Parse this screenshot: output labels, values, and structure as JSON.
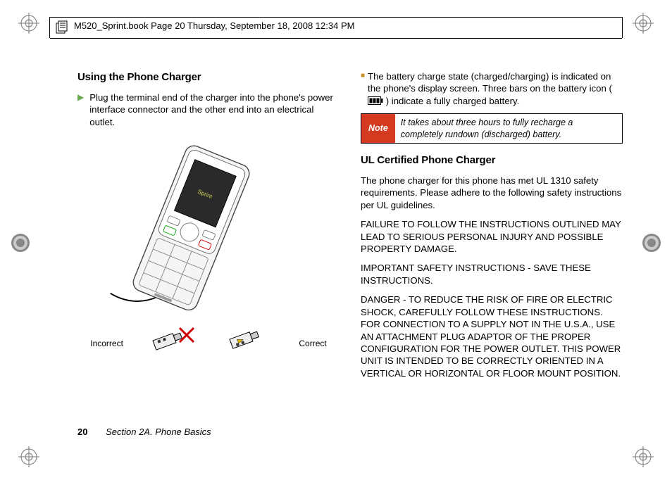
{
  "crop_header": "M520_Sprint.book  Page 20  Thursday, September 18, 2008  12:34 PM",
  "left": {
    "h1": "Using the Phone Charger",
    "step1": "Plug the terminal end of the charger into the phone's power interface connector and the other end into an electrical outlet.",
    "label_incorrect": "Incorrect",
    "label_correct": "Correct"
  },
  "right": {
    "bullet1_a": "The battery charge state (charged/charging) is indicated on the phone's display screen. Three bars on the battery icon (",
    "bullet1_b": ") indicate a fully charged battery.",
    "note_tag": "Note",
    "note_body": "It takes about three hours to fully recharge a completely rundown (discharged) battery.",
    "h2": "UL Certified Phone Charger",
    "p1": "The phone charger for this phone has met UL 1310 safety requirements. Please adhere to the following safety instructions per UL guidelines.",
    "p2": "FAILURE TO FOLLOW THE INSTRUCTIONS OUTLINED MAY LEAD TO SERIOUS PERSONAL INJURY AND POSSIBLE PROPERTY DAMAGE.",
    "p3": "IMPORTANT SAFETY INSTRUCTIONS - SAVE THESE INSTRUCTIONS.",
    "p4": "DANGER - TO REDUCE THE RISK OF FIRE OR ELECTRIC SHOCK, CAREFULLY FOLLOW THESE INSTRUCTIONS. FOR CONNECTION TO A SUPPLY NOT IN THE U.S.A., USE AN ATTACHMENT PLUG ADAPTOR OF THE PROPER CONFIGURATION FOR THE POWER OUTLET. THIS POWER UNIT IS INTENDED TO BE CORRECTLY ORIENTED IN A VERTICAL OR HORIZONTAL OR FLOOR MOUNT POSITION."
  },
  "footer": {
    "page_number": "20",
    "section": "Section 2A. Phone Basics"
  }
}
